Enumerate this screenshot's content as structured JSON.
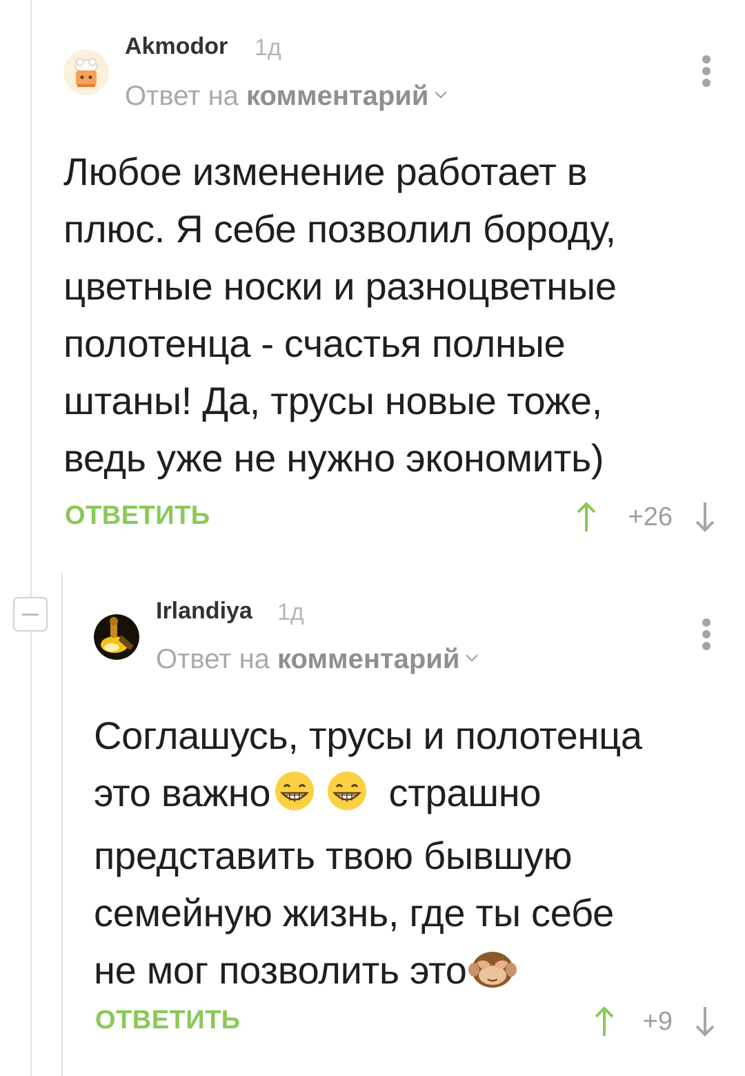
{
  "comments": [
    {
      "author": "Akmodor",
      "time": "1д",
      "reply_prefix": "Ответ на",
      "reply_link": "комментарий",
      "body_lines": [
        "Любое изменение работает в",
        "плюс. Я себе позволил бороду,",
        "цветные носки и разноцветные",
        "полотенца - счастья полные",
        "штаны! Да, трусы новые тоже,",
        "ведь уже не нужно экономить)"
      ],
      "reply_label": "ОТВЕТИТЬ",
      "rating": "+26"
    },
    {
      "author": "Irlandiya",
      "time": "1д",
      "reply_prefix": "Ответ на",
      "reply_link": "комментарий",
      "body_lines": [
        "Соглашусь, трусы и полотенца",
        "это важно",
        "страшно",
        "представить твою бывшую",
        "семейную жизнь, где ты себе",
        "не мог позволить это"
      ],
      "reply_label": "ОТВЕТИТЬ",
      "rating": "+9"
    }
  ],
  "icons": {
    "vote_up": "arrow-up-icon",
    "vote_down": "arrow-down-icon",
    "more": "vertical-dots-icon",
    "collapse": "minus-icon",
    "emoji_grin": "grinning-face-icon",
    "emoji_monkey": "see-no-evil-monkey-icon"
  },
  "colors": {
    "accent_green": "#8ac858",
    "muted_text": "#a9a9a9",
    "thread_line": "#e3e3e3"
  }
}
